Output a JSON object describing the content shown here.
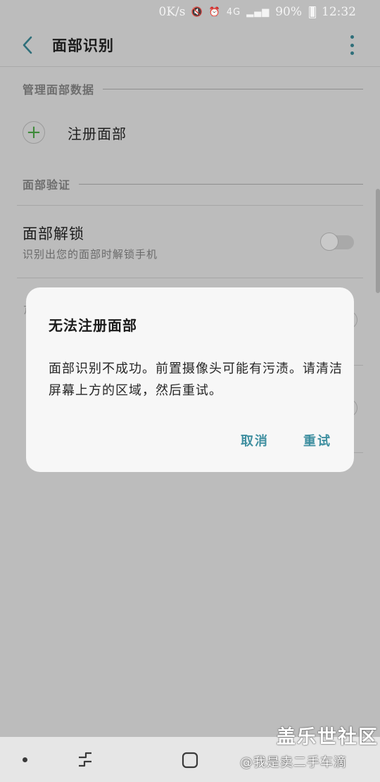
{
  "status_bar": {
    "speed": "0K/s",
    "network": "4G",
    "battery": "90%",
    "time": "12:32"
  },
  "app_bar": {
    "title": "面部识别",
    "back_icon": "chevron-left-icon",
    "more_icon": "more-vertical-icon"
  },
  "sections": {
    "manage": {
      "header": "管理面部数据",
      "add_label": "注册面部"
    },
    "verify": {
      "header": "面部验证"
    }
  },
  "face_unlock": {
    "title": "面部解锁",
    "subtitle": "识别出您的面部时解锁手机",
    "enabled": false
  },
  "dialog": {
    "title": "无法注册面部",
    "message": "面部识别不成功。前置摄像头可能有污渍。请清洁屏幕上方的区域，然后重试。",
    "cancel_label": "取消",
    "retry_label": "重试"
  },
  "watermark": {
    "brand": "盖乐世社区",
    "user": "@我是卖二手车滴"
  },
  "colors": {
    "accent": "#3f8fa0",
    "add_icon": "#3f8a3a",
    "scrim_background": "#bcbcbc"
  }
}
